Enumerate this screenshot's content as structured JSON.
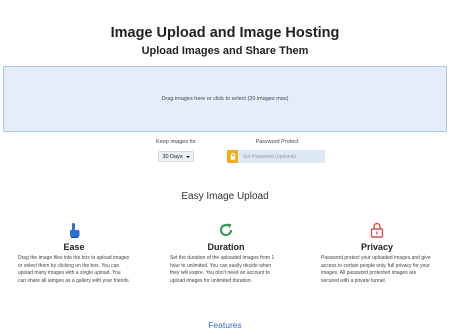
{
  "header": {
    "title": "Image Upload and Image Hosting",
    "subtitle": "Upload Images and Share Them"
  },
  "upload": {
    "dropzone_text": "Drag images here or click to select (20 images max)"
  },
  "options": {
    "keep_label": "Keep images for",
    "keep_value": "30 Days",
    "password_label": "Password Protect",
    "password_placeholder": "Set Password (optional)"
  },
  "section": {
    "title": "Easy Image Upload"
  },
  "features": [
    {
      "icon": "hand-pointer-icon",
      "title": "Ease",
      "text": "Drag the image files into the box to upload images or select them by clicking on the box. You can upload many images with a single upload. You can share all iamges as a gallery with your friends."
    },
    {
      "icon": "refresh-icon",
      "title": "Duration",
      "text": "Set the duration of the uploaded images from 1 hour to unlimited. You can easily decide when they will expire. You don't need an account to upload images for unlimited duration."
    },
    {
      "icon": "lock-icon",
      "title": "Privacy",
      "text": "Password protect your uploaded images and give access to certain people only, full privacy for your images. All password protected images are secured with a private tunnel."
    }
  ],
  "footer": {
    "features_link": "Features"
  },
  "colors": {
    "accent_blue": "#2f6fd1",
    "dropzone_bg": "#e4eefa",
    "lock_orange": "#f0ad1e",
    "duration_green": "#3a9a5a",
    "privacy_red": "#d9534f"
  }
}
